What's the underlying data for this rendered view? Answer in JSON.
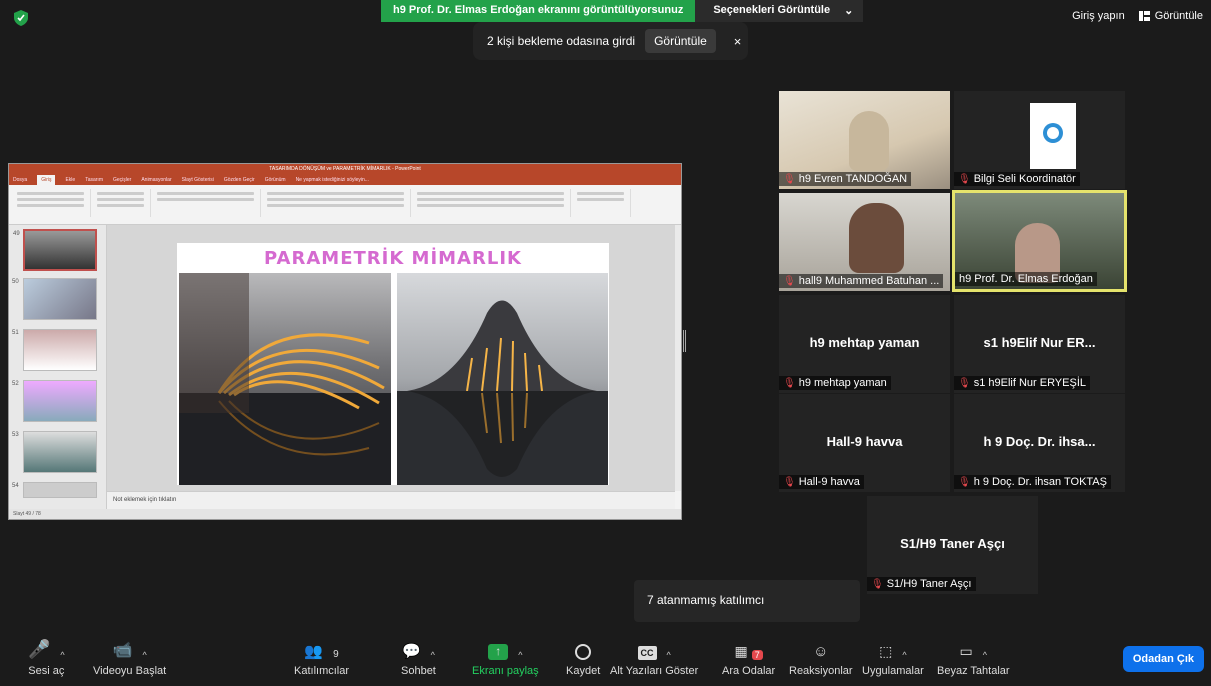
{
  "top": {
    "share_banner": "h9 Prof. Dr. Elmas Erdoğan ekranını görüntülüyorsunuz",
    "view_options": "Seçenekleri Görüntüle",
    "sign_in": "Giriş yapın",
    "view": "Görüntüle"
  },
  "waiting": {
    "text": "2 kişi bekleme odasına girdi",
    "button": "Görüntüle",
    "close": "×"
  },
  "presentation": {
    "window_title": "TASARIMDA DÖNÜŞÜM ve PARAMETRİK MİMARLIK - PowerPoint",
    "tabs": [
      "Dosya",
      "Giriş",
      "Ekle",
      "Tasarım",
      "Geçişler",
      "Animasyonlar",
      "Slayt Gösterisi",
      "Gözden Geçir",
      "Görünüm",
      "Ne yapmak istediğinizi söyleyin..."
    ],
    "slide_title": "PARAMETRİK MİMARLIK",
    "thumb_numbers": [
      "49",
      "50",
      "51",
      "52",
      "53",
      "54"
    ],
    "notes_placeholder": "Not eklemek için tıklatın",
    "status": "Slayt 49 / 78"
  },
  "tiles": [
    {
      "name": "h9 Evren TANDOĞAN",
      "big": ""
    },
    {
      "name": "Bilgi Seli Koordinatör",
      "big": ""
    },
    {
      "name": "hall9 Muhammed Batuhan ...",
      "big": ""
    },
    {
      "name": "h9 Prof. Dr. Elmas Erdoğan",
      "big": ""
    },
    {
      "name": "h9 mehtap yaman",
      "big": "h9 mehtap yaman"
    },
    {
      "name": "s1 h9Elif Nur ERYEŞİL",
      "big": "s1 h9Elif Nur ER..."
    },
    {
      "name": "Hall-9 havva",
      "big": "Hall-9 havva"
    },
    {
      "name": "h 9 Doç. Dr. ihsan TOKTAŞ",
      "big": "h 9 Doç. Dr. ihsa..."
    },
    {
      "name": "S1/H9 Taner Aşçı",
      "big": "S1/H9 Taner Aşçı"
    }
  ],
  "unassigned": "7 atanmamış katılımcı",
  "toolbar": {
    "unmute": "Sesi aç",
    "start_video": "Videoyu Başlat",
    "participants": "Katılımcılar",
    "participants_count": "9",
    "chat": "Sohbet",
    "share": "Ekranı paylaş",
    "record": "Kaydet",
    "captions": "Alt Yazıları Göster",
    "breakout": "Ara Odalar",
    "breakout_badge": "7",
    "reactions": "Reaksiyonlar",
    "apps": "Uygulamalar",
    "whiteboard": "Beyaz Tahtalar",
    "leave": "Odadan Çık"
  }
}
